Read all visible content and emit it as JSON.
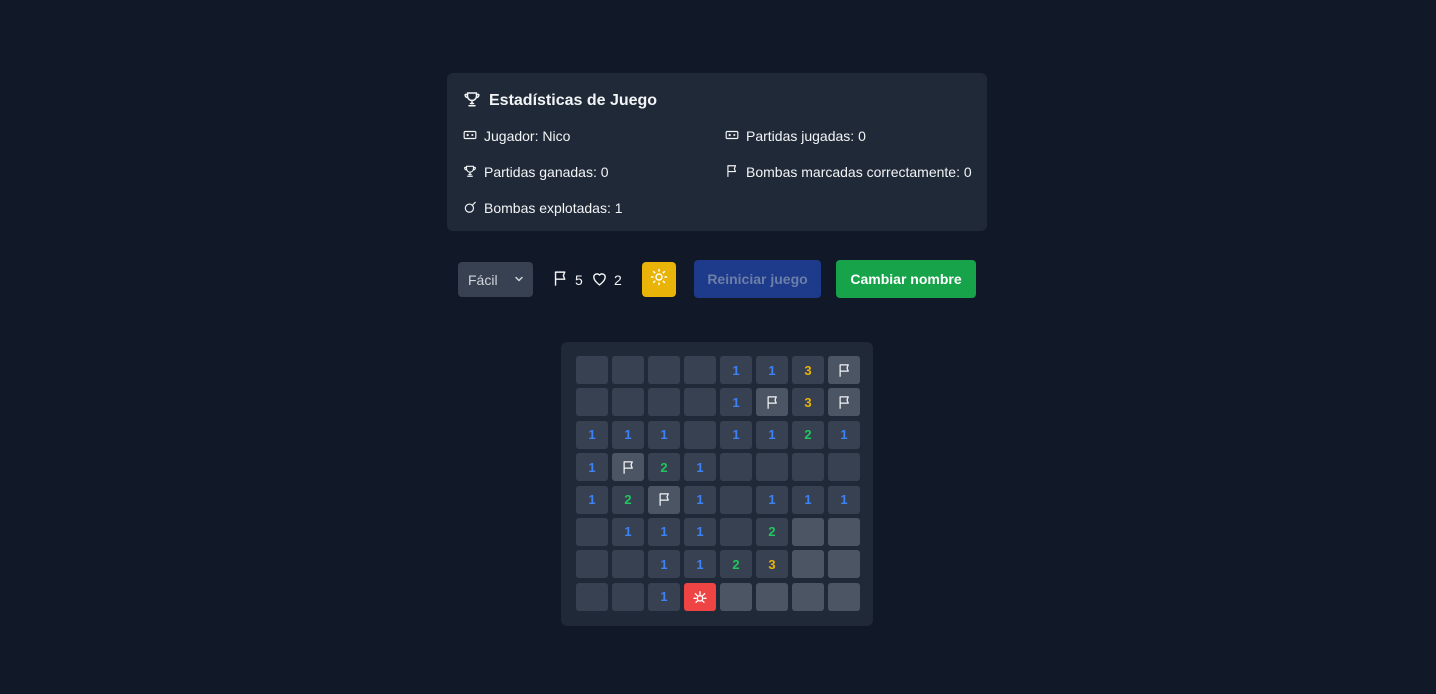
{
  "stats": {
    "title": "Estadísticas de Juego",
    "player": "Jugador: Nico",
    "games_played": "Partidas jugadas: 0",
    "games_won": "Partidas ganadas: 0",
    "bombs_flagged": "Bombas marcadas correctamente: 0",
    "bombs_exploded": "Bombas explotadas: 1"
  },
  "controls": {
    "difficulty": "Fácil",
    "flags_left": "5",
    "lives": "2",
    "restart_label": "Reiniciar juego",
    "rename_label": "Cambiar nombre"
  },
  "colors": {
    "background": "#111827",
    "panel": "#1f2937",
    "theme_button": "#eab308",
    "restart_button": "#1e3a8a",
    "rename_button": "#16a34a",
    "mine_cell": "#ef4444",
    "number_1": "#3b82f6",
    "number_2": "#22c55e",
    "number_3": "#eab308"
  },
  "board": {
    "cells": [
      [
        "R",
        "R",
        "R",
        "R",
        "1",
        "1",
        "3",
        "F"
      ],
      [
        "R",
        "R",
        "R",
        "R",
        "1",
        "F",
        "3",
        "F"
      ],
      [
        "1",
        "1",
        "1",
        "R",
        "1",
        "1",
        "2",
        "1"
      ],
      [
        "1",
        "F",
        "2",
        "1",
        "R",
        "R",
        "R",
        "R"
      ],
      [
        "1",
        "2",
        "F",
        "1",
        "R",
        "1",
        "1",
        "1"
      ],
      [
        "R",
        "1",
        "1",
        "1",
        "R",
        "2",
        "H",
        "H"
      ],
      [
        "R",
        "R",
        "1",
        "1",
        "2",
        "3",
        "H",
        "H"
      ],
      [
        "R",
        "R",
        "1",
        "M",
        "H",
        "H",
        "H",
        "H"
      ]
    ]
  }
}
